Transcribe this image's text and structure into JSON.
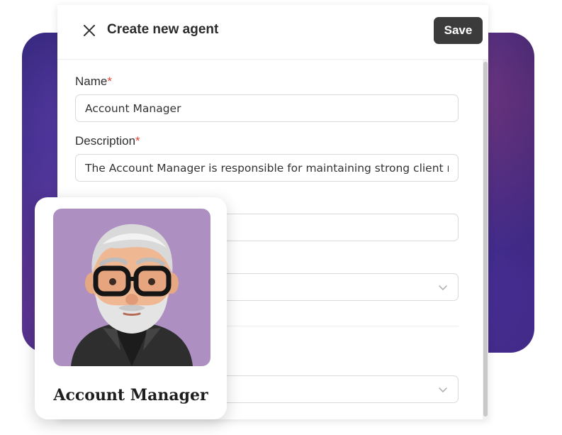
{
  "modal": {
    "title": "Create new agent",
    "save_label": "Save",
    "close_icon": "close-icon"
  },
  "form": {
    "name": {
      "label": "Name",
      "required_mark": "*",
      "value": "Account Manager"
    },
    "description": {
      "label": "Description",
      "required_mark": "*",
      "value": "The Account Manager is responsible for maintaining strong client relationships"
    }
  },
  "agent_card": {
    "name": "Account Manager",
    "avatar_icon": "avatar-icon",
    "avatar_bg": "#ad8fc1"
  },
  "colors": {
    "accent_dark": "#3b3b3b",
    "required": "#e0443a",
    "background_gradient": "#2a2070"
  }
}
